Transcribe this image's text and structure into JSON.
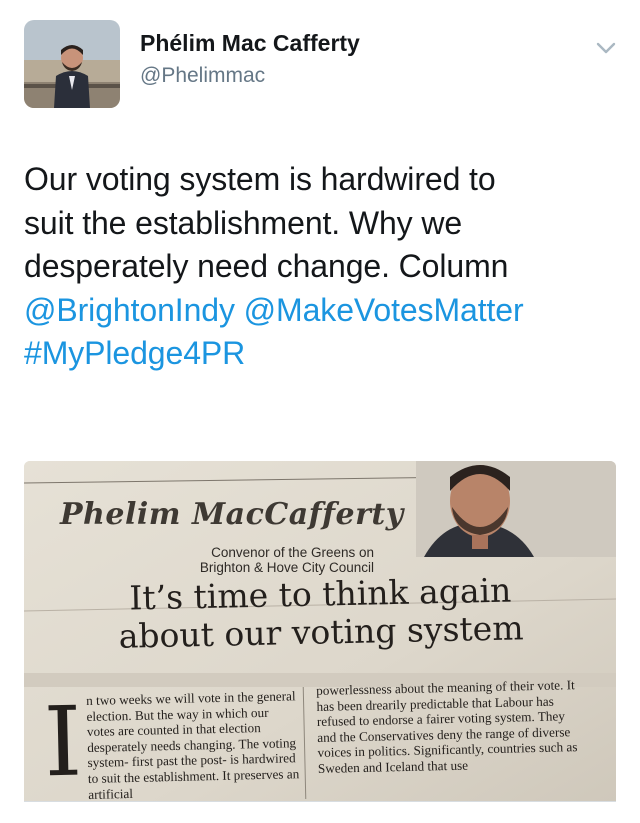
{
  "tweet": {
    "author_name": "Phélim Mac Cafferty",
    "author_handle": "@Phelimmac",
    "text_lines": [
      "Our voting system is hardwired to",
      "suit the establishment. Why we",
      "desperately need change. Column"
    ],
    "mention_1": "@BrightonIndy",
    "mention_2": "@MakeVotesMatter",
    "hashtag": "#MyPledge4PR"
  },
  "clipping": {
    "author": "Phelim MacCafferty",
    "role_line_1": "Convenor of the Greens on",
    "role_line_2": "Brighton & Hove City Council",
    "headline_line_1": "It’s time to think again",
    "headline_line_2": "about our voting system",
    "drop_cap": "I",
    "col1": "n two weeks we will vote in the general election. But the way in which our votes are counted in that election desperately needs changing. The voting system- first past the post- is hardwired to suit the establishment. It preserves an artificial",
    "col2": "powerlessness about the meaning of their vote. It has been drearily predictable that Labour has refused to endorse a fairer voting system. They and the Conservatives deny the range of diverse voices in politics. Significantly, countries such as Sweden and Iceland that use"
  },
  "colors": {
    "text": "#14171a",
    "secondary": "#657786",
    "link": "#1b95e0"
  },
  "icons": {
    "caret": "chevron-down-icon"
  }
}
